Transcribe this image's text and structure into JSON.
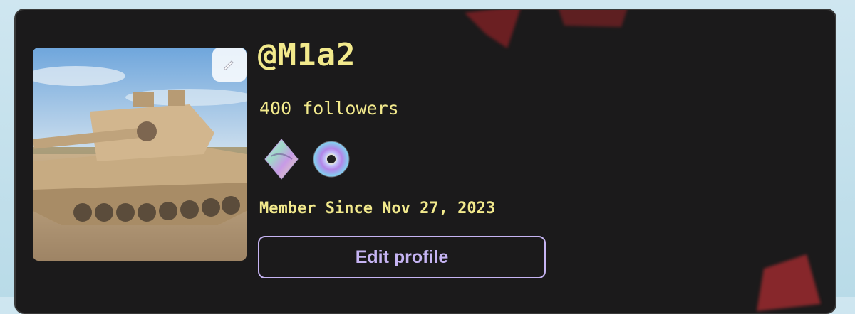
{
  "profile": {
    "username": "@M1a2",
    "followers_text": "400 followers",
    "member_since": "Member Since Nov 27, 2023",
    "edit_profile_label": "Edit profile"
  },
  "badges": [
    {
      "icon": "holographic-diamond-icon"
    },
    {
      "icon": "cd-disc-icon"
    }
  ],
  "avatar": {
    "icon": "tank-photo",
    "edit_icon": "pencil-icon"
  },
  "colors": {
    "card_bg": "#1b1a1b",
    "text_accent": "#f2e98c",
    "button_accent": "#c6b4f3",
    "page_bg": "#cfe6f0"
  }
}
